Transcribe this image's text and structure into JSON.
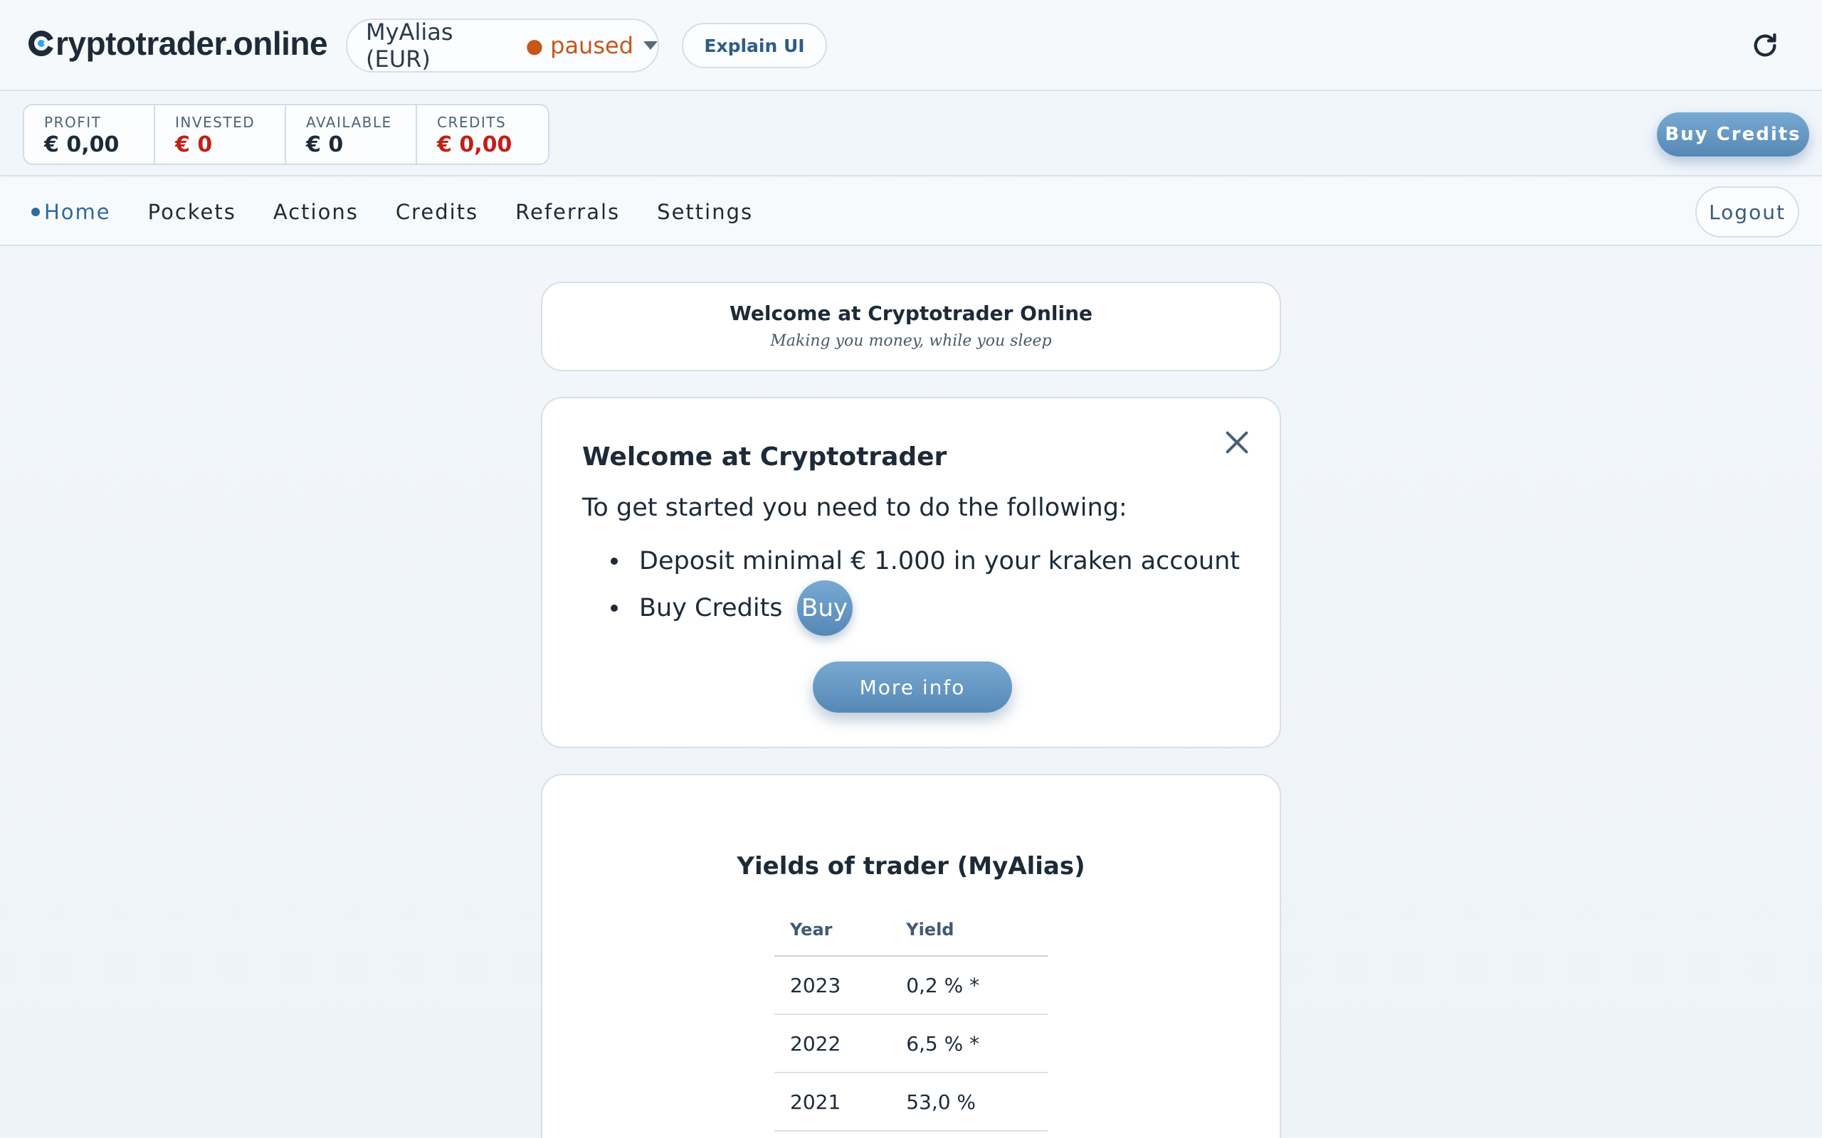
{
  "header": {
    "logo_text": "ryptotrader.online",
    "trader_select": {
      "label": "MyAlias (EUR)",
      "status_dot": "●",
      "status": "paused"
    },
    "explain_label": "Explain UI",
    "refresh_icon": "refresh-icon"
  },
  "stats": {
    "profit": {
      "label": "PROFIT",
      "value": "€ 0,00"
    },
    "invested": {
      "label": "INVESTED",
      "value": "€ 0"
    },
    "available": {
      "label": "AVAILABLE",
      "value": "€ 0"
    },
    "credits": {
      "label": "CREDITS",
      "value": "€ 0,00"
    },
    "buy_credits_label": "Buy Credits"
  },
  "nav": {
    "items": [
      {
        "label": "Home"
      },
      {
        "label": "Pockets"
      },
      {
        "label": "Actions"
      },
      {
        "label": "Credits"
      },
      {
        "label": "Referrals"
      },
      {
        "label": "Settings"
      }
    ],
    "active": "Home",
    "logout_label": "Logout"
  },
  "welcome": {
    "title": "Welcome at Cryptotrader Online",
    "subtitle": "Making you money, while you sleep"
  },
  "getting_started": {
    "title": "Welcome at Cryptotrader",
    "intro": "To get started you need to do the following:",
    "steps": [
      {
        "text": "Deposit minimal € 1.000 in your kraken account"
      },
      {
        "text": "Buy Credits",
        "button": "Buy"
      }
    ],
    "more_info_label": "More info"
  },
  "yields": {
    "title": "Yields of trader (MyAlias)",
    "columns": [
      "Year",
      "Yield"
    ],
    "rows": [
      {
        "year": "2023",
        "yield": "0,2 % *"
      },
      {
        "year": "2022",
        "yield": "6,5 % *"
      },
      {
        "year": "2021",
        "yield": "53,0 %"
      }
    ]
  },
  "colors": {
    "accent": "#5688b6",
    "status_paused": "#c7561a",
    "negative": "#c02015",
    "active_nav": "#2f6a9c"
  }
}
